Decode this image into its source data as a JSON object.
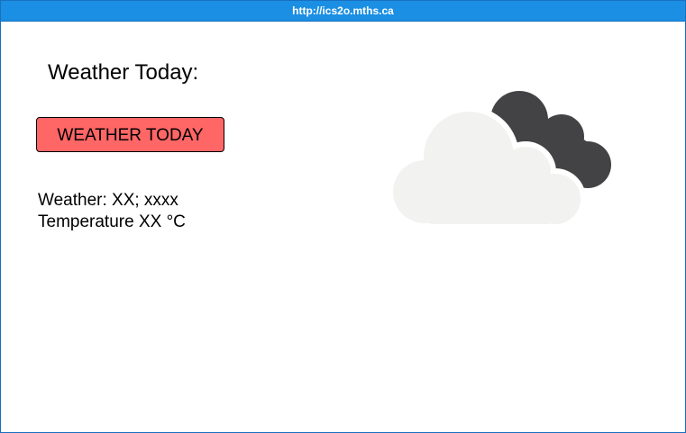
{
  "window": {
    "title": "http://ics2o.mths.ca"
  },
  "main": {
    "heading": "Weather Today:",
    "button_label": "WEATHER TODAY",
    "weather_line": "Weather: XX; xxxx",
    "temperature_line": "Temperature XX °C"
  },
  "icon": {
    "name": "cloudy-weather-icon",
    "front_cloud_color": "#f2f2f1",
    "back_cloud_color": "#434345"
  },
  "colors": {
    "titlebar": "#1a8fe3",
    "button": "#ff6666",
    "border": "#1a6fc0"
  }
}
